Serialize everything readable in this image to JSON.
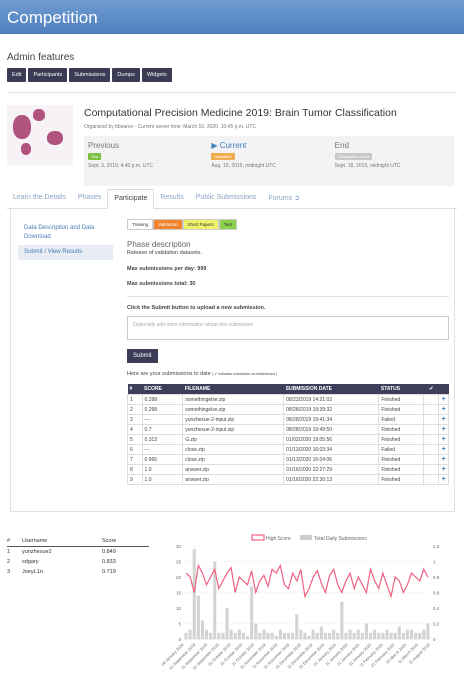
{
  "title": "Competition",
  "admin": {
    "heading": "Admin features",
    "buttons": [
      "Edit",
      "Participants",
      "Submissions",
      "Dumps",
      "Widgets"
    ]
  },
  "competition": {
    "title": "Computational Precision Medicine 2019: Brain Tumor Classification",
    "organizer": "Organized by bbearce - Current server time: March 10, 2020, 10:45 p.m. UTC"
  },
  "phases": [
    {
      "label": "Previous",
      "badge": "Test",
      "badge_color": "#7bc043",
      "date": "Sept. 3, 2019, 4:40 p.m. UTC"
    },
    {
      "label": "Current",
      "badge": "Validation",
      "badge_color": "#f0ad4e",
      "date": "Aug. 19, 2019, midnight UTC"
    },
    {
      "label": "End",
      "badge": "Competition Ends",
      "badge_color": "#c8c8c8",
      "date": "Sept. 18, 2019, midnight UTC"
    }
  ],
  "tabs": [
    "Learn the Details",
    "Phases",
    "Participate",
    "Results",
    "Public Submissions",
    "Forums"
  ],
  "leftnav": [
    "Data Description and Data Download",
    "Submit / View Results"
  ],
  "phase_pills": [
    {
      "label": "Training",
      "color": "#ffffff"
    },
    {
      "label": "Validation",
      "color": "#f0822d"
    },
    {
      "label": "Short Papers",
      "color": "#eef26a"
    },
    {
      "label": "Test",
      "color": "#8bd04a"
    }
  ],
  "phase_desc": {
    "heading": "Phase description",
    "text": "Release of validation datasets.",
    "per_day": "Max submissions per day: 999",
    "total": "Max submissions total: 30"
  },
  "submit": {
    "instruction": "Click the Submit button to upload a new submission.",
    "placeholder": "Optionally add more information about this submission",
    "button": "Submit",
    "subs_heading": "Here are your submissions to date",
    "subs_note": "( ✔ indicates submission on leaderboard )"
  },
  "table": {
    "headers": [
      "#",
      "SCORE",
      "FILENAME",
      "SUBMISSION DATE",
      "STATUS",
      "✔",
      ""
    ],
    "rows": [
      [
        "1",
        "0.298",
        "somethingelse.zip",
        "08/23/2019 14:21:03",
        "Finished"
      ],
      [
        "2",
        "0.298",
        "somethingelse.zip",
        "08/28/2019 19:39:32",
        "Finished"
      ],
      [
        "3",
        "---",
        "yunzhexue-2-input.zip",
        "08/28/2019 19:41:34",
        "Failed"
      ],
      [
        "4",
        "0.7",
        "yunzhexue-2-input.zip",
        "08/28/2019 19:49:50",
        "Finished"
      ],
      [
        "5",
        "0.313",
        "G.zip",
        "01/02/2020 19:05:56",
        "Finished"
      ],
      [
        "6",
        "---",
        "close.zip",
        "01/13/2020 16:03:34",
        "Failed"
      ],
      [
        "7",
        "0.965",
        "close.zip",
        "01/13/2020 16:04:06",
        "Finished"
      ],
      [
        "8",
        "1.0",
        "answer.zip",
        "01/16/2020 22:27:29",
        "Finished"
      ],
      [
        "9",
        "1.0",
        "answer.zip",
        "01/16/2020 22:30:13",
        "Finished"
      ]
    ]
  },
  "leaderboard": {
    "headers": [
      "#",
      "Username",
      "Score"
    ],
    "rows": [
      [
        "1",
        "yunzhexue2",
        "0.849"
      ],
      [
        "2",
        "sdgary",
        "0.833"
      ],
      [
        "3",
        "JoeyL1n",
        "0.719"
      ]
    ]
  },
  "chart_data": {
    "type": "bar",
    "legend": [
      "High Score",
      "Total Daily Submissions"
    ],
    "categories": [
      "08 January 2020",
      "01 September 2019",
      "11 September 2019",
      "21 September 2019",
      "01 October 2019",
      "11 October 2019",
      "21 October 2019",
      "01 November 2019",
      "11 November 2019",
      "21 November 2019",
      "01 December 2019",
      "11 December 2019",
      "21 December 2019",
      "01 January 2020",
      "11 January 2020",
      "21 January 2020",
      "31 January 2020",
      "11 February 2020",
      "21 February 2020",
      "01 March 2020",
      "11 March 2020",
      "21 August 2019"
    ],
    "y_left": [
      0,
      5,
      10,
      15,
      20,
      25,
      30
    ],
    "y_right": [
      -0.0,
      0.2,
      0.4,
      0.6,
      0.8,
      1.0,
      1.2
    ],
    "submissions": [
      2,
      3,
      29,
      14,
      6,
      3,
      2,
      25,
      2,
      2,
      10,
      3,
      2,
      3,
      2,
      1,
      17,
      5,
      2,
      3,
      2,
      2,
      1,
      3,
      2,
      2,
      2,
      8,
      3,
      2,
      1,
      3,
      2,
      4,
      2,
      2,
      3,
      2,
      12,
      2,
      3,
      2,
      3,
      2,
      5,
      2,
      3,
      2,
      2,
      3,
      2,
      2,
      4,
      2,
      3,
      3,
      2,
      2,
      3,
      5
    ],
    "high_score": [
      0.85,
      0.8,
      0.6,
      0.95,
      0.85,
      0.7,
      0.8,
      0.9,
      0.65,
      0.75,
      0.85,
      0.92,
      0.6,
      0.8,
      0.75,
      0.7,
      0.88,
      0.6,
      0.75,
      0.82,
      0.68,
      0.9,
      0.85,
      0.95,
      0.7,
      0.65,
      0.85,
      0.75,
      0.9,
      0.55,
      0.65,
      0.8,
      0.88,
      0.72,
      0.6,
      0.82,
      0.9,
      0.7,
      0.6,
      0.75,
      0.85,
      0.65,
      0.8,
      0.7,
      0.6,
      0.9,
      0.75,
      0.65,
      0.85,
      0.7,
      0.55,
      0.8,
      0.75,
      0.6,
      0.7,
      0.85,
      0.8,
      0.75,
      0.9,
      0.8
    ]
  }
}
